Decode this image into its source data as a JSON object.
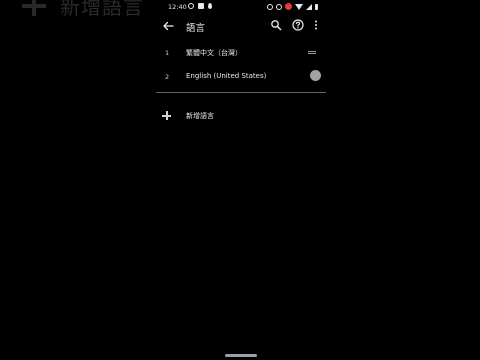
{
  "ghost_overlay": {
    "label": "新增語言"
  },
  "status_bar": {
    "time": "12:40"
  },
  "toolbar": {
    "title": "語言",
    "back_icon": "arrow-back-icon",
    "search_icon": "search-icon",
    "help_icon": "help-icon",
    "more_icon": "more-vert-icon"
  },
  "languages": [
    {
      "number": "1",
      "label": "繁體中文（台灣）"
    },
    {
      "number": "2",
      "label": "English (United States)"
    }
  ],
  "add_language": {
    "label": "新增語言",
    "icon": "plus-icon"
  },
  "colors": {
    "background": "#000000",
    "text": "#e8eaed",
    "divider": "#5f6368",
    "notification": "#e53935"
  }
}
